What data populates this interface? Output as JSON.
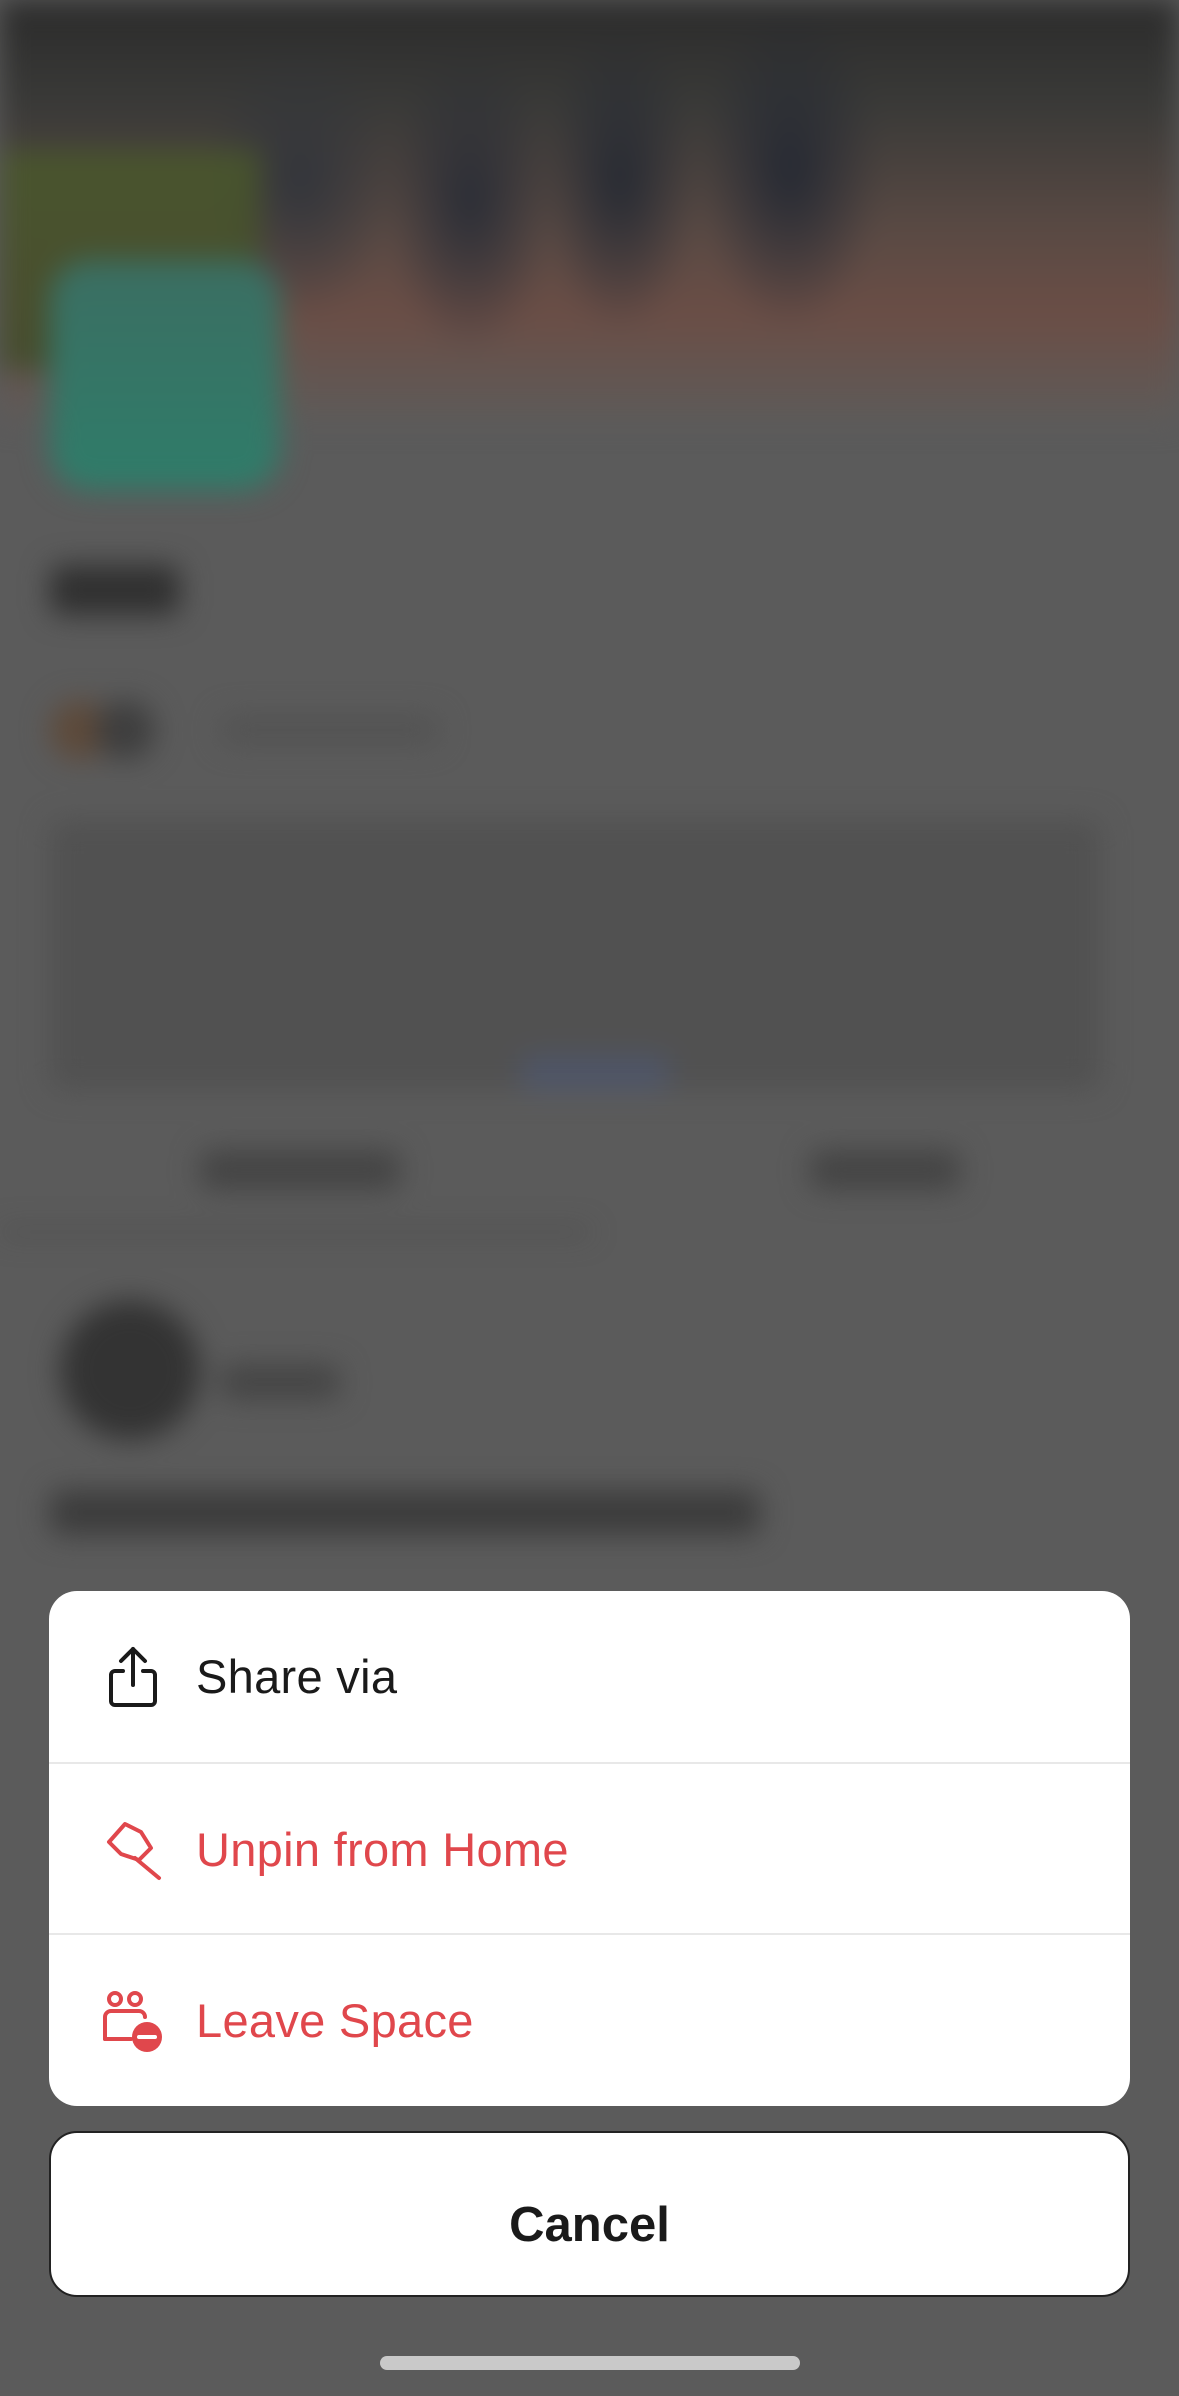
{
  "action_sheet": {
    "items": [
      {
        "label": "Share via",
        "icon": "share-icon",
        "style": "default"
      },
      {
        "label": "Unpin from Home",
        "icon": "unpin-icon",
        "style": "destructive"
      },
      {
        "label": "Leave Space",
        "icon": "leave-space-icon",
        "style": "destructive"
      }
    ],
    "cancel_label": "Cancel"
  },
  "colors": {
    "destructive": "#e0474c",
    "default_text": "#1a1a1a",
    "sheet_background": "#ffffff",
    "overlay": "#5b5b5b"
  }
}
